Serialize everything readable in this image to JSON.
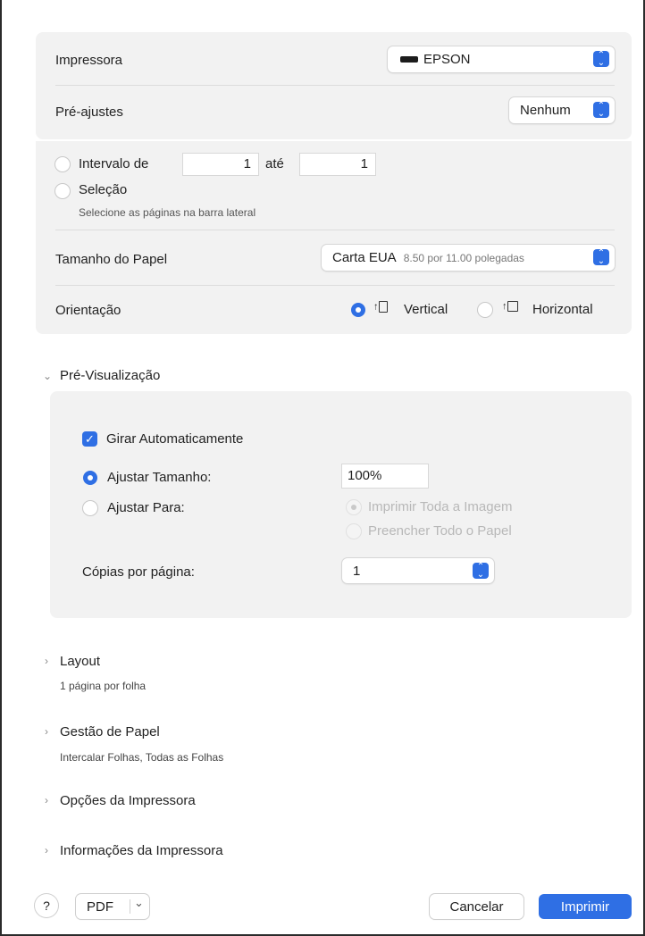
{
  "printer": {
    "label": "Impressora",
    "value": "EPSON"
  },
  "presets": {
    "label": "Pré-ajustes",
    "value": "Nenhum"
  },
  "pages": {
    "range_label": "Intervalo de",
    "range_from": "1",
    "range_to_label": "até",
    "range_to": "1",
    "selection_label": "Seleção",
    "selection_hint": "Selecione as páginas na barra lateral"
  },
  "paper_size": {
    "label": "Tamanho do Papel",
    "value": "Carta EUA",
    "detail": "8.50 por 11.00 polegadas"
  },
  "orientation": {
    "label": "Orientação",
    "vertical": "Vertical",
    "horizontal": "Horizontal",
    "selected": "vertical"
  },
  "preview_section": {
    "title": "Pré-Visualização",
    "auto_rotate": "Girar Automaticamente",
    "auto_rotate_checked": true,
    "scale_label": "Ajustar Tamanho:",
    "scale_value": "100%",
    "fit_label": "Ajustar Para:",
    "fit_option1": "Imprimir Toda a Imagem",
    "fit_option2": "Preencher Todo o Papel",
    "copies_label": "Cópias por página:",
    "copies_value": "1"
  },
  "sections": [
    {
      "title": "Layout",
      "subtitle": "1 página por folha"
    },
    {
      "title": "Gestão de Papel",
      "subtitle": "Intercalar Folhas, Todas as Folhas"
    },
    {
      "title": "Opções da Impressora",
      "subtitle": ""
    },
    {
      "title": "Informações da Impressora",
      "subtitle": ""
    }
  ],
  "footer": {
    "help": "?",
    "pdf": "PDF",
    "cancel": "Cancelar",
    "print": "Imprimir"
  },
  "colors": {
    "accent": "#2f6fe4",
    "panel": "#f2f2f2"
  }
}
